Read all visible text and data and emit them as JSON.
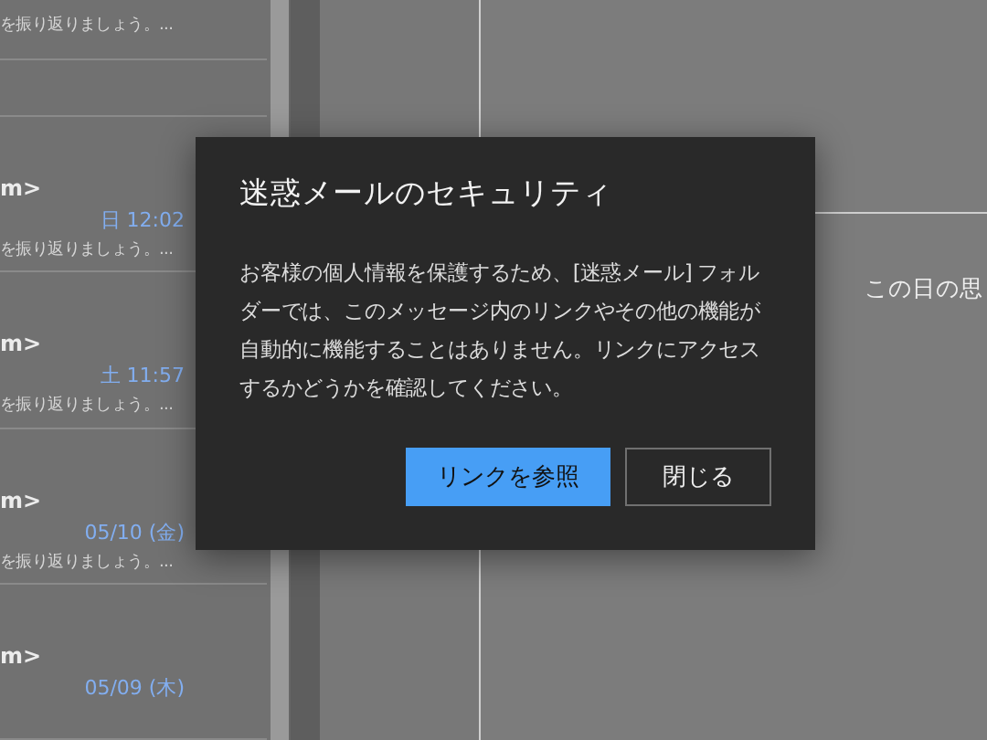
{
  "message_list": {
    "top_preview": "を振り返りましょう。...",
    "items": [
      {
        "sender": "m>",
        "date": "日 12:02",
        "preview": "を振り返りましょう。..."
      },
      {
        "sender": "m>",
        "date": "土 11:57",
        "preview": "を振り返りましょう。..."
      },
      {
        "sender": "m>",
        "date": "05/10 (金)",
        "preview": "を振り返りましょう。..."
      },
      {
        "sender": "m>",
        "date": "05/09 (木)"
      }
    ]
  },
  "reading_pane": {
    "text": "この日の思"
  },
  "dialog": {
    "title": "迷惑メールのセキュリティ",
    "body": "お客様の個人情報を保護するため、[迷惑メール] フォルダーでは、このメッセージ内のリンクやその他の機能が自動的に機能することはありません。リンクにアクセスするかどうかを確認してください。",
    "buttons": [
      {
        "label": "リンクを参照",
        "kind": "primary"
      },
      {
        "label": "閉じる",
        "kind": "secondary"
      }
    ]
  }
}
